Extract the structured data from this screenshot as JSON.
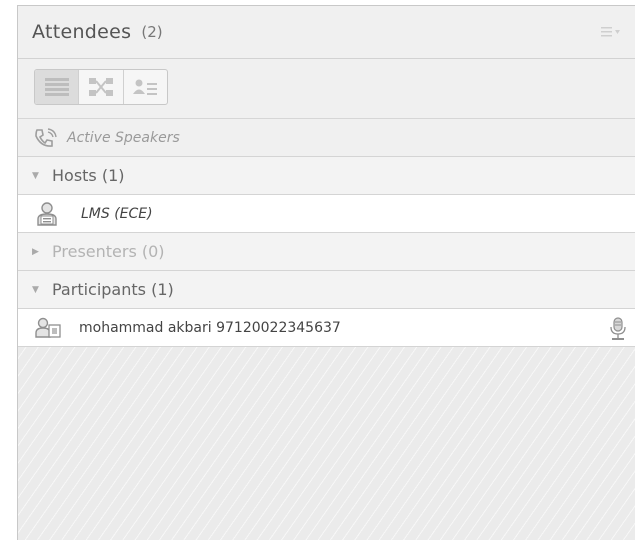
{
  "panel": {
    "title": "Attendees",
    "count": "(2)"
  },
  "active_speakers": {
    "label": "Active Speakers"
  },
  "groups": {
    "hosts": {
      "label": "Hosts (1)",
      "members": [
        {
          "name": "LMS (ECE)"
        }
      ]
    },
    "presenters": {
      "label": "Presenters (0)"
    },
    "participants": {
      "label": "Participants (1)",
      "members": [
        {
          "name": "mohammad akbari 97120022345637"
        }
      ]
    }
  },
  "icons": {
    "menu": "menu-icon",
    "list_view": "list-view-icon",
    "breakout_view": "breakout-view-icon",
    "status_view": "status-view-icon",
    "speaker": "speaker-phone-icon",
    "host": "host-user-icon",
    "participant": "participant-user-icon",
    "microphone": "microphone-icon"
  }
}
